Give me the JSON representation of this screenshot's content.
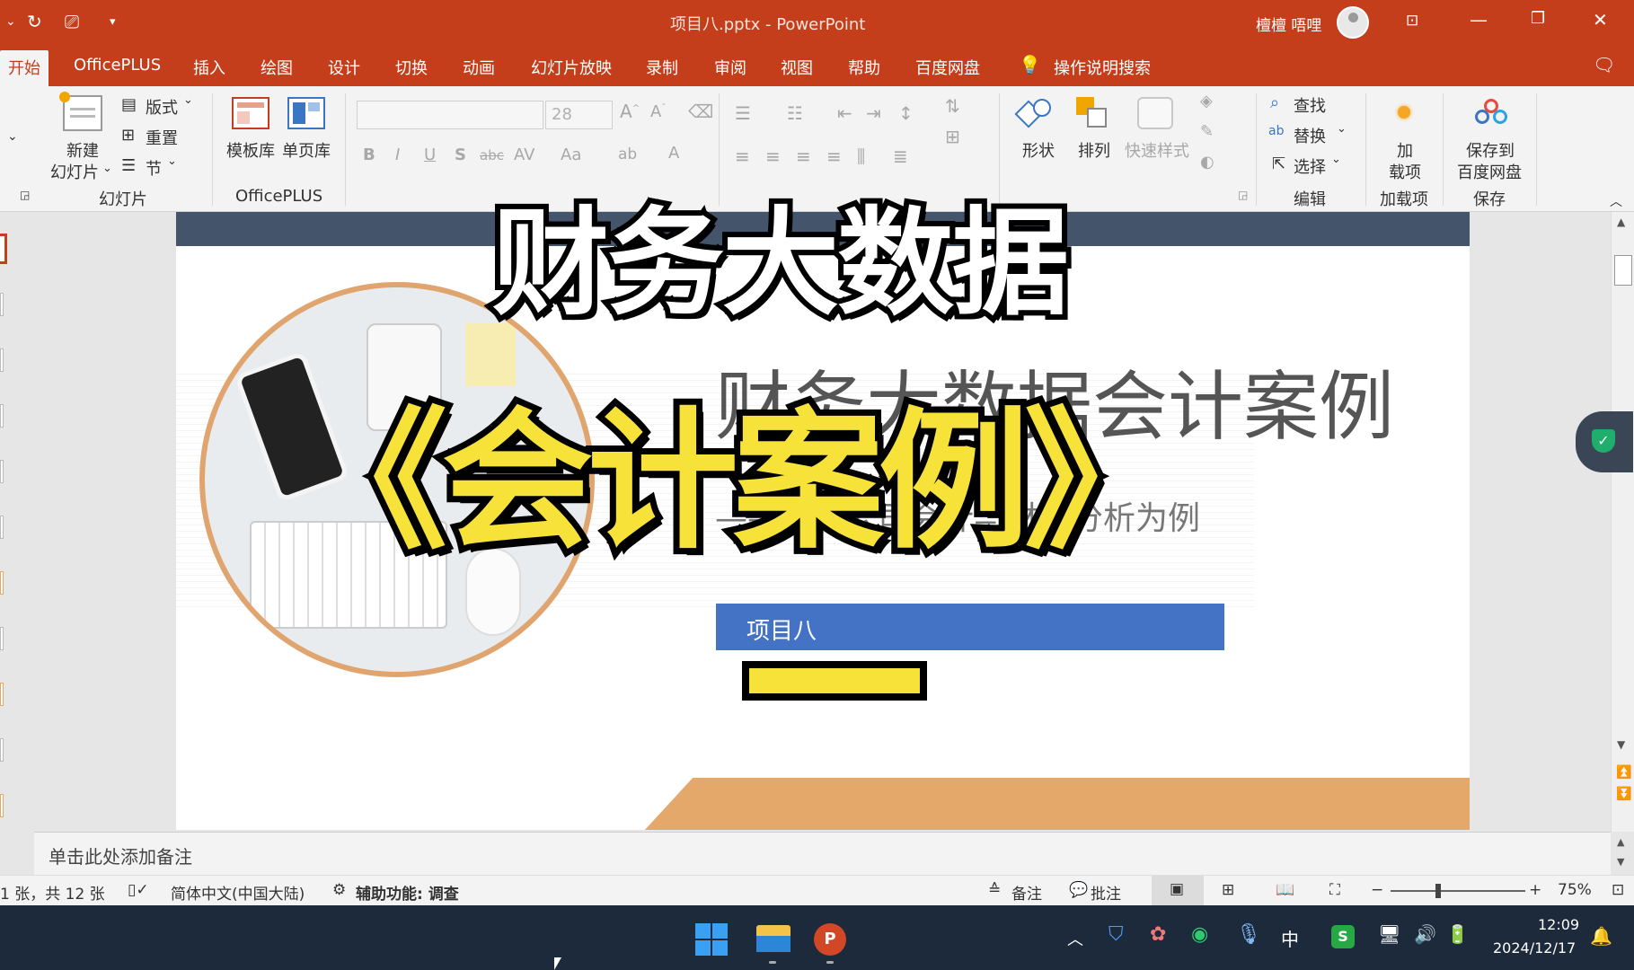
{
  "window": {
    "title": "项目八.pptx - PowerPoint",
    "user": "檀檀 唔哩"
  },
  "tabs": [
    "开始",
    "OfficePLUS",
    "插入",
    "绘图",
    "设计",
    "切换",
    "动画",
    "幻灯片放映",
    "录制",
    "审阅",
    "视图",
    "帮助",
    "百度网盘"
  ],
  "tell_me": "操作说明搜索",
  "ribbon": {
    "slides": {
      "new_slide_line1": "新建",
      "new_slide_line2": "幻灯片",
      "layout": "版式",
      "reset": "重置",
      "section": "节",
      "group": "幻灯片"
    },
    "officeplus": {
      "template_lib": "模板库",
      "single_page_lib": "单页库",
      "group": "OfficePLUS"
    },
    "font": {
      "size": "28",
      "bold": "B",
      "italic": "I",
      "underline": "U",
      "shadow": "S",
      "strike": "abc",
      "spacing": "AV",
      "case": "Aa",
      "color": "A"
    },
    "drawing": {
      "shapes": "形状",
      "arrange": "排列",
      "quick_styles": "快速样式"
    },
    "editing": {
      "find": "查找",
      "replace": "替换",
      "select": "选择",
      "group": "编辑"
    },
    "addins": {
      "label_line1": "加",
      "label_line2": "载项",
      "group": "加载项"
    },
    "save": {
      "label_line1": "保存到",
      "label_line2": "百度网盘",
      "group": "保存"
    }
  },
  "slide": {
    "bg_title": "财务大数据会计案例",
    "bg_subtitle": "——以市公司会计与财务分析为例",
    "project_label": "项目八",
    "colors": {
      "band_top": "#44546a",
      "label_blue": "#4472c4",
      "accent_orange": "#e4a86a"
    }
  },
  "overlay": {
    "line1": "财务大数据",
    "line2": "《会计案例》",
    "dash": "一"
  },
  "notes_placeholder": "单击此处添加备注",
  "status": {
    "slide_count": "1 张，共 12 张",
    "language": "简体中文(中国大陆)",
    "accessibility": "辅助功能: 调查",
    "notes": "备注",
    "comments": "批注",
    "zoom": "75%"
  },
  "taskbar": {
    "time": "12:09",
    "date": "2024/12/17",
    "ime": "中"
  }
}
